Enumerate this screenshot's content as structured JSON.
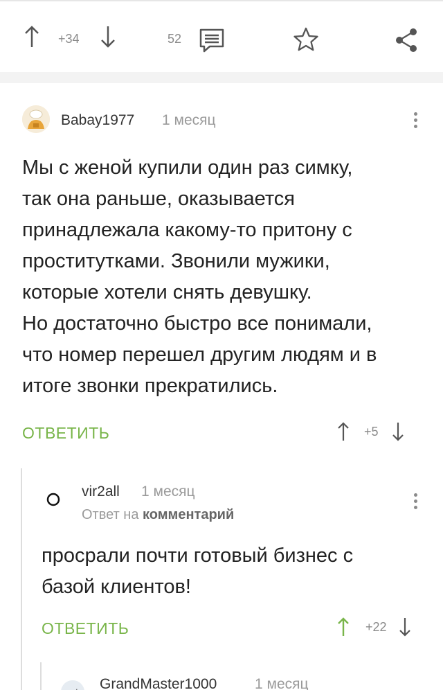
{
  "colors": {
    "accent_green": "#79b54a",
    "muted": "#8a8a8a"
  },
  "top_bar": {
    "rating": "+34",
    "comments_count": "52"
  },
  "comment1": {
    "author": "Babay1977",
    "time": "1 месяц",
    "lines": [
      "Мы с женой купили один раз симку,",
      "так она раньше,  оказывается",
      "принадлежала какому-то притону с",
      "проститутками. Звонили мужики,",
      "которые хотели снять девушку.",
      "Но достаточно быстро все понимали,",
      "что номер перешел другим людям и в",
      "итоге звонки прекратились."
    ],
    "reply_label": "ОТВЕТИТЬ",
    "rating": "+5"
  },
  "comment2": {
    "author": "vir2all",
    "time": "1 месяц",
    "reply_to_prefix": "Ответ на",
    "reply_to_link": "комментарий",
    "lines": [
      "просрали почти готовый бизнес с",
      "базой клиентов!"
    ],
    "reply_label": "ОТВЕТИТЬ",
    "rating": "+22"
  },
  "comment3": {
    "author": "GrandMaster1000",
    "time": "1 месяц"
  }
}
